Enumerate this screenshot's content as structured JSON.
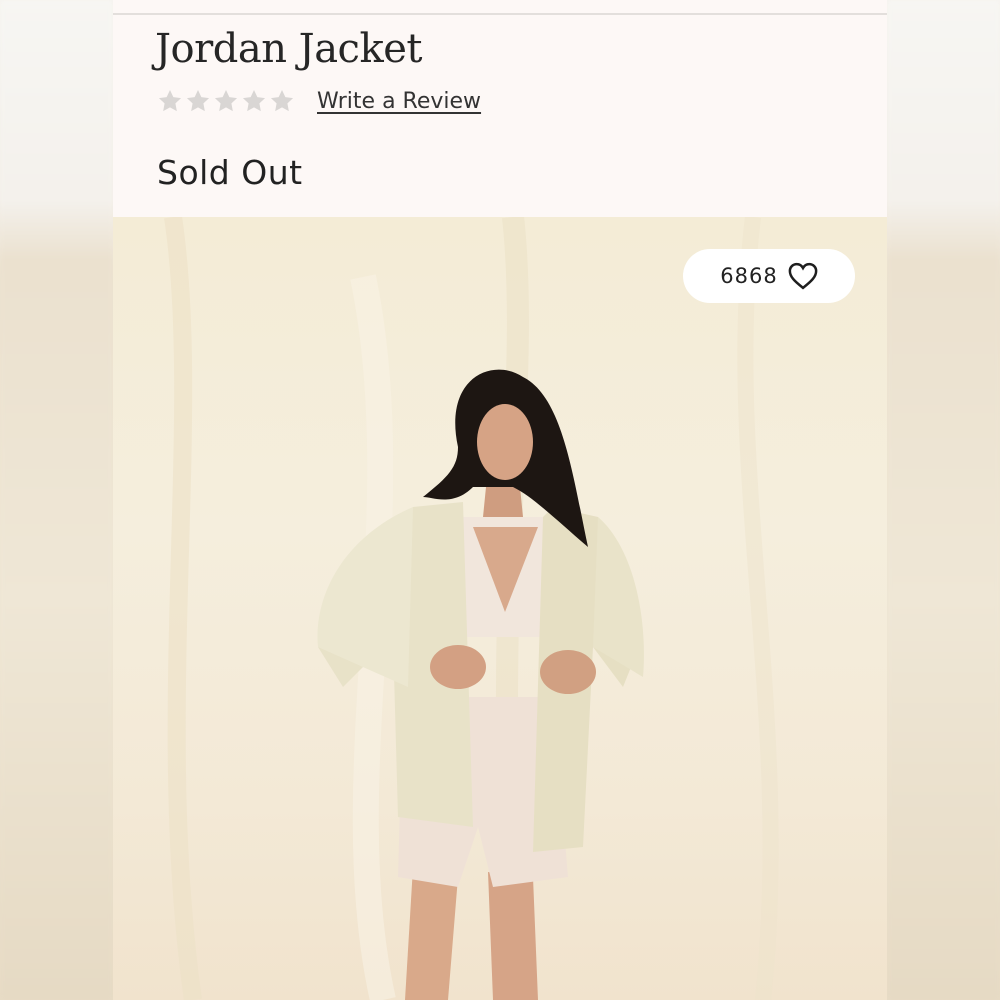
{
  "product": {
    "title": "Jordan Jacket",
    "rating": 0,
    "rating_max": 5,
    "write_review_label": "Write a Review",
    "availability": "Sold Out"
  },
  "image": {
    "likes_count": "6868",
    "like_icon": "heart-outline-icon"
  },
  "colors": {
    "page_background": "#fdf8f6",
    "star_empty": "#d9d6d4",
    "text": "#262626",
    "likes_pill": "#ffffff"
  }
}
